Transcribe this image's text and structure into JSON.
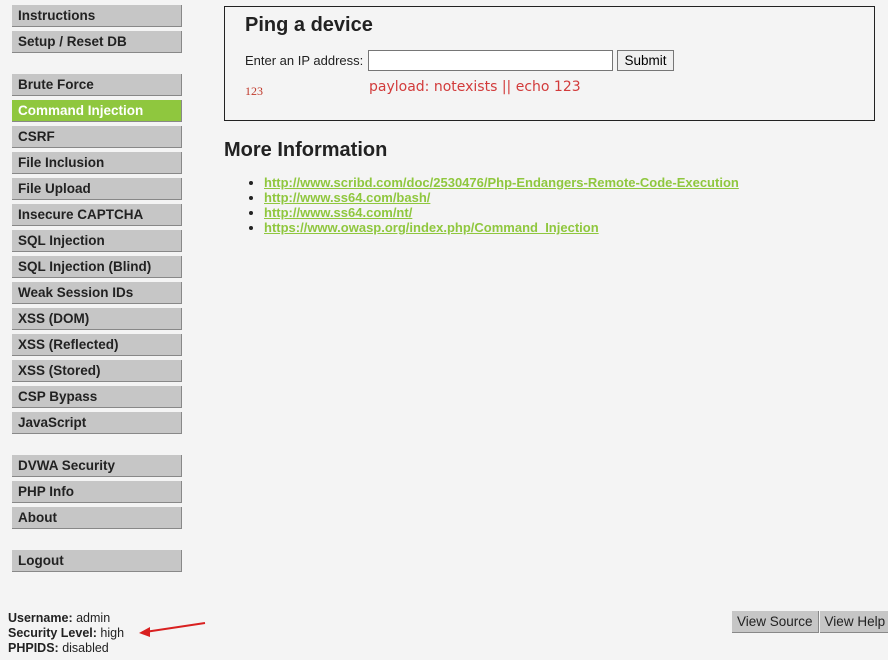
{
  "menu": {
    "group1": [
      "Instructions",
      "Setup / Reset DB"
    ],
    "group2": [
      "Brute Force",
      "Command Injection",
      "CSRF",
      "File Inclusion",
      "File Upload",
      "Insecure CAPTCHA",
      "SQL Injection",
      "SQL Injection (Blind)",
      "Weak Session IDs",
      "XSS (DOM)",
      "XSS (Reflected)",
      "XSS (Stored)",
      "CSP Bypass",
      "JavaScript"
    ],
    "group3": [
      "DVWA Security",
      "PHP Info",
      "About"
    ],
    "group4": [
      "Logout"
    ],
    "selected": "Command Injection"
  },
  "ping": {
    "title": "Ping a device",
    "label": "Enter an IP address:",
    "input_value": "",
    "submit_label": "Submit",
    "output": "123",
    "annotation": "payload: notexists || echo 123"
  },
  "more_info": {
    "title": "More Information",
    "links": [
      "http://www.scribd.com/doc/2530476/Php-Endangers-Remote-Code-Execution",
      "http://www.ss64.com/bash/",
      "http://www.ss64.com/nt/",
      "https://www.owasp.org/index.php/Command_Injection"
    ]
  },
  "user": {
    "username_label": "Username:",
    "username": "admin",
    "security_label": "Security Level:",
    "security": "high",
    "phpids_label": "PHPIDS:",
    "phpids": "disabled"
  },
  "footer": {
    "view_source": "View Source",
    "view_help": "View Help"
  },
  "colors": {
    "accent": "#8fc73e",
    "annotation": "#d23b3b",
    "menu_bg": "#c6c6c6"
  }
}
